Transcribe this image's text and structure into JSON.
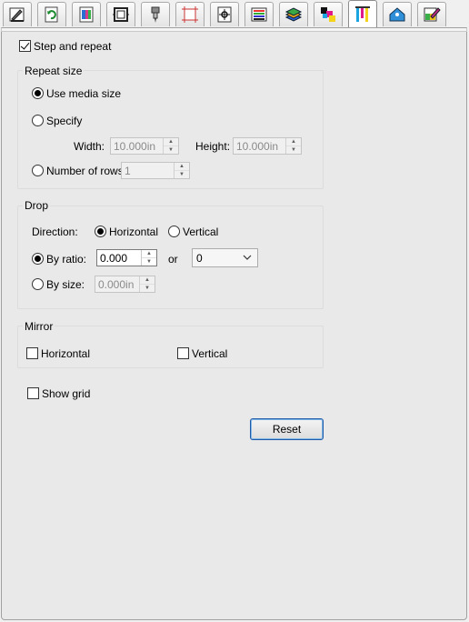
{
  "tabs": [
    {
      "icon": "pen-plot-icon"
    },
    {
      "icon": "refresh-page-icon"
    },
    {
      "icon": "color-image-icon"
    },
    {
      "icon": "frame-icon"
    },
    {
      "icon": "cut-tool-icon"
    },
    {
      "icon": "crop-marks-icon"
    },
    {
      "icon": "target-icon"
    },
    {
      "icon": "color-bars-icon"
    },
    {
      "icon": "layers-icon"
    },
    {
      "icon": "cmyk-icon"
    },
    {
      "icon": "step-repeat-icon"
    },
    {
      "icon": "tag-icon"
    },
    {
      "icon": "color-picker-icon"
    }
  ],
  "active_tab_index": 10,
  "step_repeat": {
    "label": "Step and repeat",
    "checked": true
  },
  "repeat_size": {
    "title": "Repeat size",
    "use_media_size": "Use media size",
    "specify": "Specify",
    "width_label": "Width:",
    "width_value": "10.000in",
    "height_label": "Height:",
    "height_value": "10.000in",
    "rows_label": "Number of rows:",
    "rows_value": "1"
  },
  "drop": {
    "title": "Drop",
    "direction_label": "Direction:",
    "horizontal": "Horizontal",
    "vertical": "Vertical",
    "by_ratio_label": "By ratio:",
    "ratio_value": "0.000",
    "or_label": "or",
    "ratio_select_value": "0",
    "by_size_label": "By size:",
    "size_value": "0.000in"
  },
  "mirror": {
    "title": "Mirror",
    "horizontal": "Horizontal",
    "vertical": "Vertical"
  },
  "show_grid": "Show grid",
  "reset_button": "Reset",
  "colors": {
    "accent_border": "#1e5aa8"
  }
}
